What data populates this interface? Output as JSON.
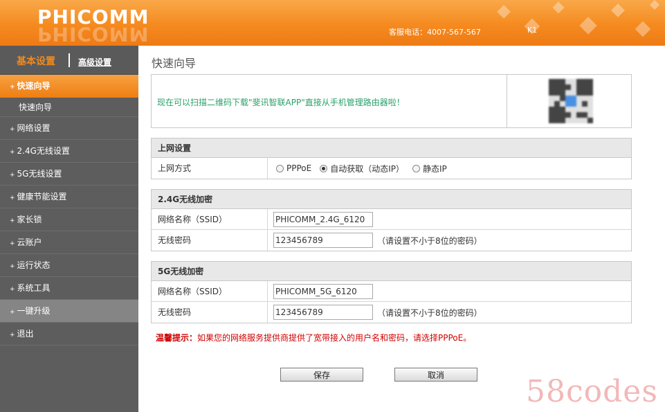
{
  "header": {
    "logo": "PHICOMM",
    "hotline": "客服电话：4007-567-567",
    "model": "K1"
  },
  "sidebar": {
    "basic_label": "基本设置",
    "advanced_label": "高级设置",
    "items": [
      {
        "label": "快速向导"
      },
      {
        "label": "快速向导"
      },
      {
        "label": "网络设置"
      },
      {
        "label": "2.4G无线设置"
      },
      {
        "label": "5G无线设置"
      },
      {
        "label": "健康节能设置"
      },
      {
        "label": "家长锁"
      },
      {
        "label": "云账户"
      },
      {
        "label": "运行状态"
      },
      {
        "label": "系统工具"
      },
      {
        "label": "一键升级"
      },
      {
        "label": "退出"
      }
    ]
  },
  "main": {
    "title": "快速向导",
    "banner_text": "现在可以扫描二维码下载\"斐讯智联APP\"直接从手机管理路由器啦！",
    "internet": {
      "title": "上网设置",
      "mode_label": "上网方式",
      "options": [
        "PPPoE",
        "自动获取（动态IP）",
        "静态IP"
      ],
      "selected": "自动获取（动态IP）"
    },
    "wifi24": {
      "title": "2.4G无线加密",
      "ssid_label": "网络名称（SSID）",
      "ssid_value": "PHICOMM_2.4G_6120",
      "pwd_label": "无线密码",
      "pwd_value": "123456789",
      "pwd_hint": "（请设置不小于8位的密码）"
    },
    "wifi5": {
      "title": "5G无线加密",
      "ssid_label": "网络名称（SSID）",
      "ssid_value": "PHICOMM_5G_6120",
      "pwd_label": "无线密码",
      "pwd_value": "123456789",
      "pwd_hint": "（请设置不小于8位的密码）"
    },
    "tip_title": "温馨提示：",
    "tip_text": "如果您的网络服务提供商提供了宽带接入的用户名和密码，请选择PPPoE。",
    "save_label": "保存",
    "cancel_label": "取消"
  },
  "watermark": "58codes",
  "colors": {
    "accent": "#f58a1f",
    "sidebar_bg": "#5d5d5d",
    "banner_text": "#2aa06a",
    "tip": "#d10000"
  }
}
